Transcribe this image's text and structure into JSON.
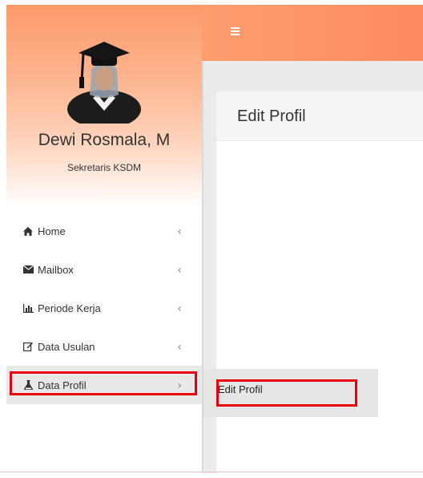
{
  "user": {
    "name": "Dewi Rosmala, M",
    "role": "Sekretaris KSDM"
  },
  "menu": {
    "items": [
      {
        "label": "Home",
        "icon": "home-icon",
        "chevron": "‹"
      },
      {
        "label": "Mailbox",
        "icon": "envelope-icon",
        "chevron": "‹"
      },
      {
        "label": "Periode Kerja",
        "icon": "bar-chart-icon",
        "chevron": "‹"
      },
      {
        "label": "Data Usulan",
        "icon": "edit-icon",
        "chevron": "‹"
      },
      {
        "label": "Data Profil",
        "icon": "flask-icon",
        "chevron": "›",
        "active": true
      }
    ]
  },
  "submenu": {
    "items": [
      {
        "label": "Edit Profil"
      }
    ]
  },
  "page": {
    "title": "Edit Profil"
  },
  "header": {
    "menu_toggle_icon": "hamburger-icon"
  },
  "colors": {
    "accent": "#fd9a6a",
    "highlight": "#e8000f"
  }
}
